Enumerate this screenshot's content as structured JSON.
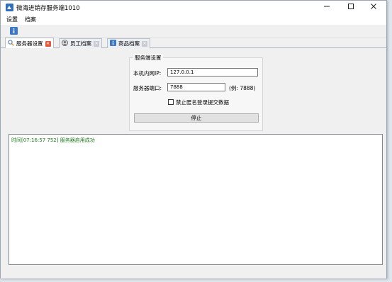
{
  "window": {
    "title": "微海进销存服务端1010"
  },
  "menu": {
    "items": [
      {
        "label": "设置"
      },
      {
        "label": "档案"
      }
    ]
  },
  "tabs": [
    {
      "label": "服务器设置",
      "active": true
    },
    {
      "label": "员工档案",
      "active": false
    },
    {
      "label": "商品档案",
      "active": false
    }
  ],
  "server_settings": {
    "group_title": "服务端设置",
    "ip_label": "本机内网IP:",
    "ip_value": "127.0.0.1",
    "port_label": "服务器端口:",
    "port_value": "7888",
    "port_hint": "(例: 7888)",
    "anonymous_checkbox_label": "禁止匿名登录提交数据",
    "anonymous_checked": false,
    "stop_button_label": "停止"
  },
  "log": {
    "lines": [
      "时间[07:16:57 752] 服务器启用成功"
    ],
    "color": "#1a7a1a"
  },
  "colors": {
    "active_tab_close": "#e15a3c",
    "inactive_tab_close": "#c7ccd2",
    "toolbar_icon": "#3a78c9"
  }
}
